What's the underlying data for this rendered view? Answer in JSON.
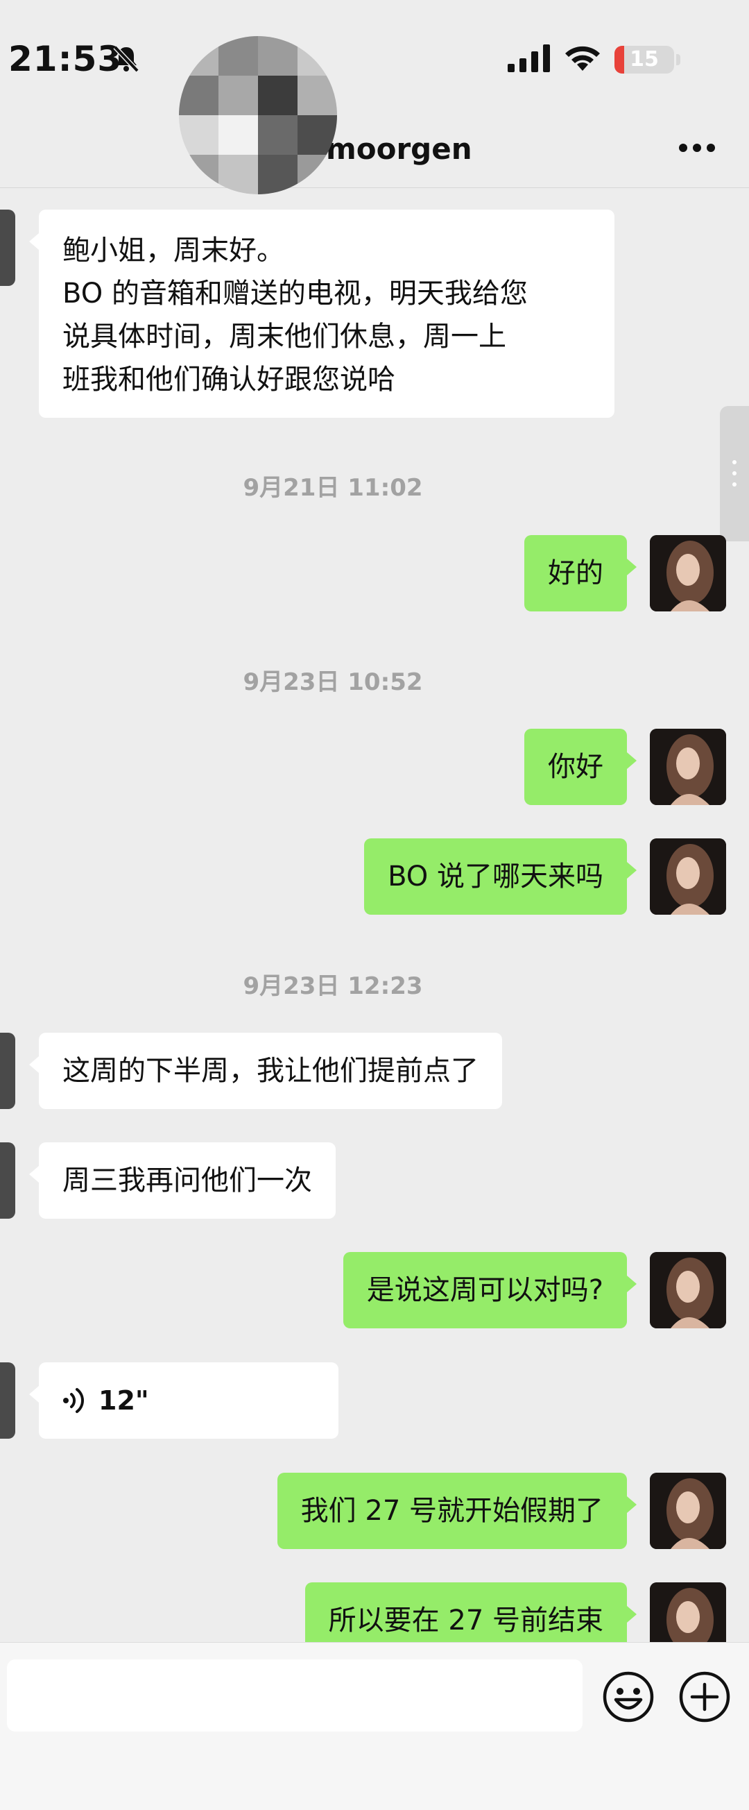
{
  "status": {
    "time": "21:53",
    "battery": "15"
  },
  "header": {
    "contact_name": "moorgen"
  },
  "timestamps": [
    "9月21日 11:02",
    "9月23日 10:52",
    "9月23日 12:23"
  ],
  "messages": {
    "m1_lines": [
      "鲍小姐，周末好。",
      "BO 的音箱和赠送的电视，明天我给您",
      "说具体时间，周末他们休息，周一上",
      "班我和他们确认好跟您说哈"
    ],
    "m2": "好的",
    "m3": "你好",
    "m4": "BO 说了哪天来吗",
    "m5": "这周的下半周，我让他们提前点了",
    "m6": "周三我再问他们一次",
    "m7": "是说这周可以对吗?",
    "voice_duration": "12\"",
    "m9": "我们 27 号就开始假期了",
    "m10": "所以要在 27 号前结束"
  },
  "colors": {
    "outgoing": "#95ec69",
    "incoming": "#ffffff",
    "background": "#ededed"
  },
  "icons": [
    "bell-slash-icon",
    "signal-icon",
    "wifi-icon",
    "more-icon",
    "voice-icon",
    "emoji-icon",
    "plus-icon"
  ]
}
